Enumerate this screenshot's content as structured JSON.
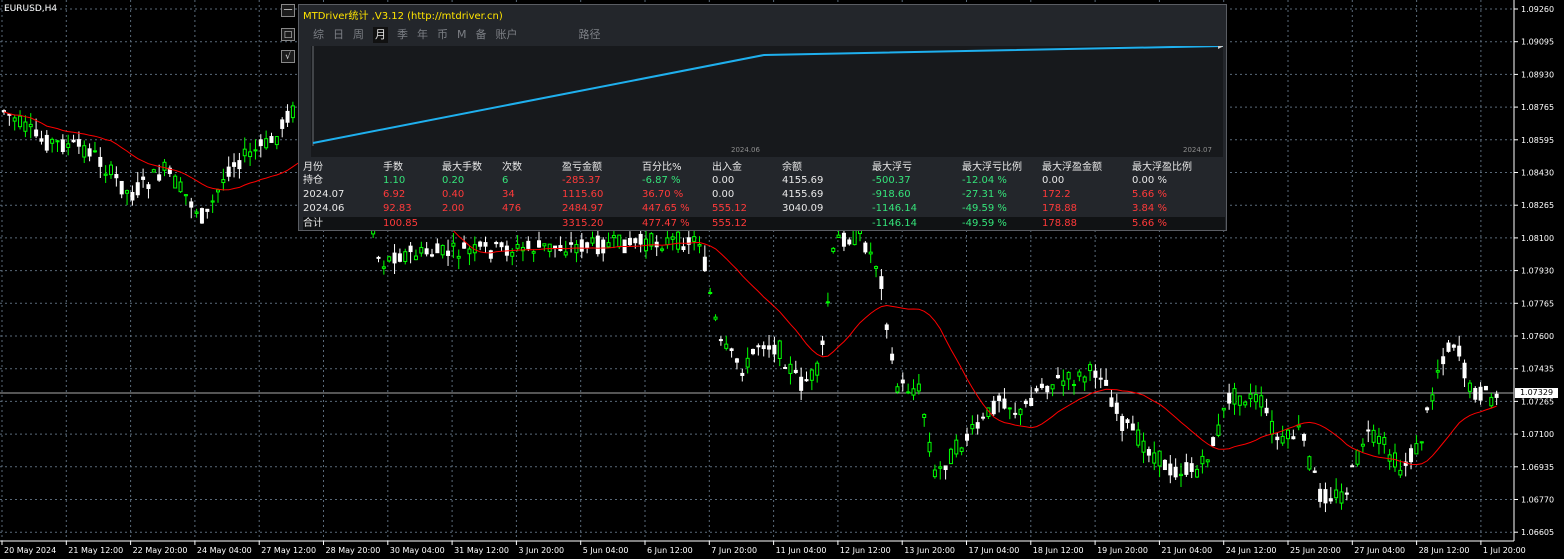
{
  "symbol": "EURUSD,H4",
  "price_axis": [
    "1.09260",
    "1.09095",
    "1.08930",
    "1.08765",
    "1.08595",
    "1.08430",
    "1.08265",
    "1.08100",
    "1.07930",
    "1.07765",
    "1.07600",
    "1.07435",
    "1.07265",
    "1.07100",
    "1.06935",
    "1.06770",
    "1.06605"
  ],
  "current_price": "1.07329",
  "time_axis": [
    "20 May 2024",
    "21 May 12:00",
    "22 May 20:00",
    "24 May 04:00",
    "27 May 12:00",
    "28 May 20:00",
    "30 May 04:00",
    "31 May 12:00",
    "3 Jun 20:00",
    "5 Jun 04:00",
    "6 Jun 12:00",
    "7 Jun 20:00",
    "11 Jun 04:00",
    "12 Jun 12:00",
    "13 Jun 20:00",
    "17 Jun 04:00",
    "18 Jun 12:00",
    "19 Jun 20:00",
    "21 Jun 04:00",
    "24 Jun 12:00",
    "25 Jun 20:00",
    "27 Jun 04:00",
    "28 Jun 12:00",
    "1 Jul 20:00"
  ],
  "side_buttons": [
    "一",
    "□",
    "√"
  ],
  "panel": {
    "title": "MTDriver统计 ,V3.12 (http://mtdriver.cn)",
    "tabs": [
      "综",
      "日",
      "周",
      "月",
      "季",
      "年",
      "币",
      "M",
      "备",
      "账户"
    ],
    "active_tab": "月",
    "path_tab": "路径",
    "mini_chart": {
      "x_labels": [
        "2024.06",
        "2024.07"
      ],
      "line_color": "#1fb0ee"
    },
    "headers": [
      "月份",
      "手数",
      "最大手数",
      "次数",
      "盈亏金额",
      "百分比%",
      "出入金",
      "余额",
      "最大浮亏",
      "最大浮亏比例",
      "最大浮盈金额",
      "最大浮盈比例"
    ],
    "rows": [
      [
        "持仓",
        "1.10",
        "0.20",
        "6",
        "-285.37",
        "-6.87 %",
        "0.00",
        "4155.69",
        "-500.37",
        "-12.04 %",
        "0.00",
        "0.00 %"
      ],
      [
        "2024.07",
        "6.92",
        "0.40",
        "34",
        "1115.60",
        "36.70 %",
        "0.00",
        "4155.69",
        "-918.60",
        "-27.31 %",
        "172.2",
        "5.66 %"
      ],
      [
        "2024.06",
        "92.83",
        "2.00",
        "476",
        "2484.97",
        "447.65 %",
        "555.12",
        "3040.09",
        "-1146.14",
        "-49.59 %",
        "178.88",
        "3.84 %"
      ],
      [
        "合计",
        "100.85",
        "",
        "",
        "3315.20",
        "477.47 %",
        "555.12",
        "",
        "-1146.14",
        "-49.59 %",
        "178.88",
        "5.66 %"
      ]
    ],
    "row_colors": [
      [
        "white",
        "green",
        "green",
        "green",
        "red",
        "green",
        "white",
        "white",
        "green",
        "green",
        "white",
        "white"
      ],
      [
        "white",
        "red",
        "red",
        "red",
        "red",
        "red",
        "white",
        "white",
        "green",
        "green",
        "red",
        "red"
      ],
      [
        "white",
        "red",
        "red",
        "red",
        "red",
        "red",
        "red",
        "white",
        "green",
        "green",
        "red",
        "red"
      ],
      [
        "white",
        "red",
        "red",
        "red",
        "red",
        "red",
        "red",
        "white",
        "green",
        "green",
        "red",
        "red"
      ]
    ]
  },
  "colors": {
    "background": "#000000",
    "bull": "#00ff00",
    "bear": "#ffffff",
    "ma_line": "#ff0000",
    "grid": "#5a6a7a"
  }
}
